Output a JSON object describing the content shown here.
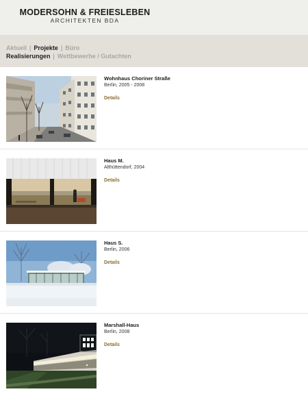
{
  "header": {
    "logo_main": "MODERSOHN & FREIESLEBEN",
    "logo_sub": "ARCHITEKTEN BDA"
  },
  "nav": {
    "row1": [
      {
        "label": "Aktuell",
        "active": false
      },
      {
        "label": "Projekte",
        "active": true
      },
      {
        "label": "Büro",
        "active": false
      }
    ],
    "row2": [
      {
        "label": "Realisierungen",
        "active": true
      },
      {
        "label": "Wettbewerbe / Gutachten",
        "active": false
      }
    ],
    "separator": "|"
  },
  "projects": [
    {
      "title": "Wohnhaus Choriner Straße",
      "meta": "Berlin, 2005 - 2008",
      "details": "Details",
      "image": "street-apartments-photo"
    },
    {
      "title": "Haus M.",
      "meta": "Althüttendorf, 2004",
      "details": "Details",
      "image": "lake-view-interior-photo"
    },
    {
      "title": "Haus S.",
      "meta": "Berlin, 2006",
      "details": "Details",
      "image": "glass-house-winter-photo"
    },
    {
      "title": "Marshall-Haus",
      "meta": "Berlin, 2008",
      "details": "Details",
      "image": "night-pavilion-photo"
    }
  ],
  "colors": {
    "header_bg": "#efefeb",
    "nav_bg": "#e2e0d9",
    "details_link": "#8c6d2e",
    "nav_inactive": "#a9a79f"
  }
}
